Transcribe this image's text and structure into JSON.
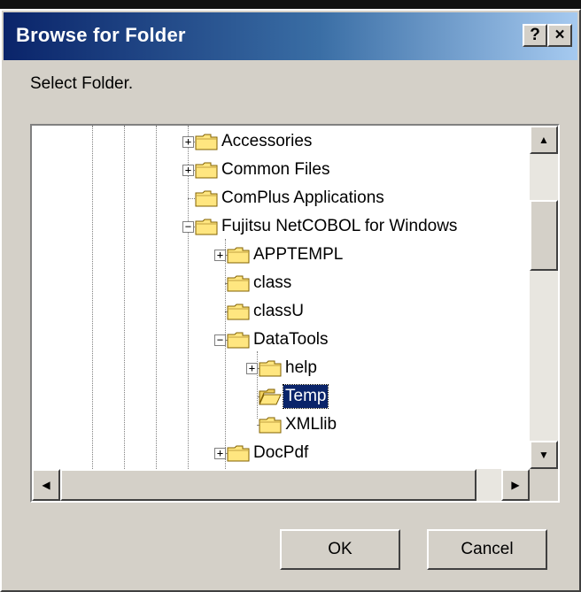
{
  "dialog": {
    "title": "Browse for Folder",
    "help_button": "?",
    "close_button": "×",
    "prompt": "Select Folder."
  },
  "tree": {
    "nodes": [
      {
        "label": "Accessories",
        "expander": "+"
      },
      {
        "label": "Common Files",
        "expander": "+"
      },
      {
        "label": "ComPlus Applications",
        "expander": ""
      },
      {
        "label": "Fujitsu NetCOBOL for Windows",
        "expander": "−"
      },
      {
        "label": "APPTEMPL",
        "expander": "+"
      },
      {
        "label": "class",
        "expander": ""
      },
      {
        "label": "classU",
        "expander": ""
      },
      {
        "label": "DataTools",
        "expander": "−"
      },
      {
        "label": "help",
        "expander": "+"
      },
      {
        "label": "Temp",
        "expander": "",
        "selected": true
      },
      {
        "label": "XMLlib",
        "expander": ""
      },
      {
        "label": "DocPdf",
        "expander": "+"
      }
    ]
  },
  "scrollbar": {
    "up_arrow": "▲",
    "down_arrow": "▼",
    "left_arrow": "◀",
    "right_arrow": "▶"
  },
  "buttons": {
    "ok": "OK",
    "cancel": "Cancel"
  },
  "colors": {
    "title_gradient_start": "#0a246a",
    "title_gradient_end": "#a6caf0",
    "selection": "#0a246a",
    "folder": "#ffe680"
  }
}
